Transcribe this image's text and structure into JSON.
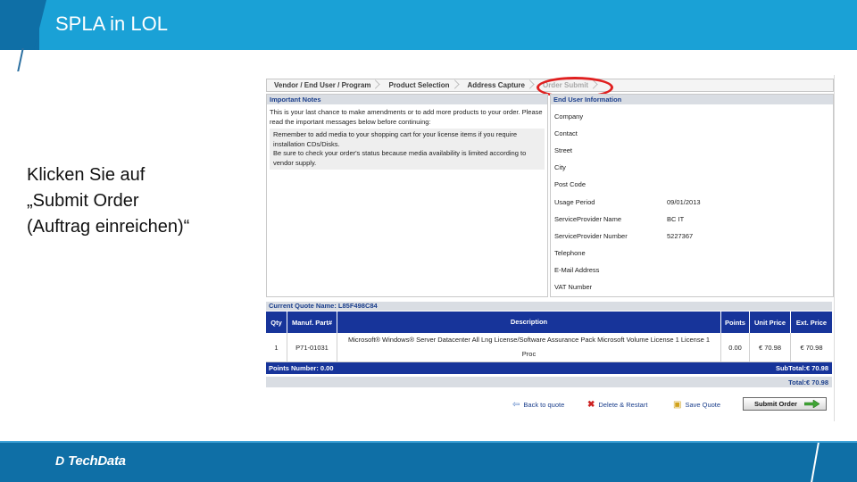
{
  "slide": {
    "title": "SPLA in LOL",
    "instruction_lines": [
      "Klicken Sie auf",
      "„Submit Order",
      "(Auftrag einreichen)“"
    ],
    "footer_logo": {
      "mark": "D",
      "text": "TechData"
    }
  },
  "breadcrumb": [
    {
      "label": "Vendor / End User / Program",
      "state": "done"
    },
    {
      "label": "Product Selection",
      "state": "done"
    },
    {
      "label": "Address Capture",
      "state": "done"
    },
    {
      "label": "Order Submit",
      "state": "current"
    }
  ],
  "important_notes": {
    "heading": "Important Notes",
    "intro": "This is your last chance to make amendments or to add more products to your order. Please read the important messages below before continuing:",
    "messages": [
      "Remember to add media to your shopping cart for your license items if you require installation CDs/Disks.",
      "Be sure to check your order's status because media availability is limited according to vendor supply."
    ]
  },
  "end_user": {
    "heading": "End User Information",
    "fields": [
      {
        "label": "Company",
        "value": ""
      },
      {
        "label": "Contact",
        "value": ""
      },
      {
        "label": "Street",
        "value": ""
      },
      {
        "label": "City",
        "value": ""
      },
      {
        "label": "Post Code",
        "value": ""
      },
      {
        "label": "Usage Period",
        "value": "09/01/2013"
      },
      {
        "label": "ServiceProvider Name",
        "value": "BC IT"
      },
      {
        "label": "ServiceProvider Number",
        "value": "5227367"
      },
      {
        "label": "Telephone",
        "value": ""
      },
      {
        "label": "E-Mail Address",
        "value": ""
      },
      {
        "label": "VAT Number",
        "value": ""
      }
    ]
  },
  "quote": {
    "name_label": "Current Quote Name: L85F498C84",
    "columns": {
      "qty": "Qty",
      "part": "Manuf. Part#",
      "desc": "Description",
      "points": "Points",
      "unit": "Unit Price",
      "ext": "Ext. Price"
    },
    "rows": [
      {
        "qty": "1",
        "part": "P71-01031",
        "desc": "Microsoft® Windows® Server Datacenter All Lng License/Software Assurance Pack Microsoft Volume License 1 License 1 Proc",
        "points": "0.00",
        "unit": "€ 70.98",
        "ext": "€ 70.98"
      }
    ],
    "points_number": "Points Number: 0.00",
    "subtotal": "SubTotal:€ 70.98",
    "total": "Total:€ 70.98"
  },
  "actions": {
    "back": "Back to quote",
    "delete": "Delete & Restart",
    "save": "Save Quote",
    "submit": "Submit Order"
  },
  "colors": {
    "title_bar": "#1aa1d6",
    "footer": "#0f6fa6",
    "table_header": "#17349a",
    "highlight_ring": "#e02020"
  }
}
